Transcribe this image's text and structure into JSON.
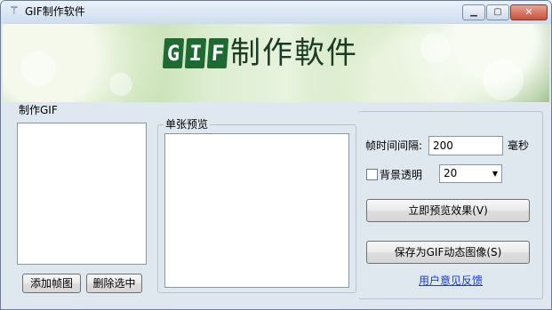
{
  "window": {
    "title": "GIF制作软件",
    "icon": "magic-wand-icon",
    "controls": {
      "minimize": "▁",
      "maximize": "▢",
      "close": "✕"
    }
  },
  "banner": {
    "logo_letters": [
      "G",
      "I",
      "F"
    ],
    "title": "制作軟件"
  },
  "make_group": {
    "title": "制作GIF",
    "add_button": "添加帧图",
    "delete_button": "删除选中"
  },
  "preview_group": {
    "title": "单张预览"
  },
  "settings": {
    "frame_interval_label": "帧时间间隔:",
    "frame_interval_value": "200",
    "unit_label": "毫秒",
    "transparent_bg_label": "背景透明",
    "transparent_bg_checked": false,
    "tolerance_value": "20",
    "preview_button": "立即预览效果(V)",
    "save_button": "保存为GIF动态图像(S)",
    "feedback_link": "用户意见反馈"
  },
  "colors": {
    "window_bg": "#dfe7ef",
    "logo_tile": "#1d6b33",
    "link": "#1a3fd6"
  }
}
